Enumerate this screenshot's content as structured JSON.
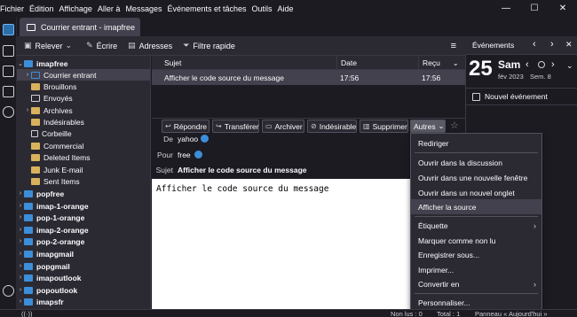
{
  "menubar": {
    "items": [
      "Fichier",
      "Édition",
      "Affichage",
      "Aller à",
      "Messages",
      "Événements et tâches",
      "Outils",
      "Aide"
    ]
  },
  "window_controls": {
    "minimize": "—",
    "maximize": "☐",
    "close": "✕"
  },
  "tab": {
    "title": "Courrier entrant - imapfree"
  },
  "toolbar": {
    "get_messages": "Relever",
    "write": "Écrire",
    "address_book": "Adresses",
    "quick_filter": "Filtre rapide",
    "menu_icon": "≡"
  },
  "folders": [
    {
      "label": "imapfree",
      "type": "account",
      "expanded": true,
      "bold": true
    },
    {
      "label": "Courrier entrant",
      "type": "inbox",
      "selected": true
    },
    {
      "label": "Brouillons",
      "type": "folder"
    },
    {
      "label": "Envoyés",
      "type": "sent"
    },
    {
      "label": "Archives",
      "type": "folder",
      "collapsible": true
    },
    {
      "label": "Indésirables",
      "type": "folder"
    },
    {
      "label": "Corbeille",
      "type": "trash"
    },
    {
      "label": "Commercial",
      "type": "folder"
    },
    {
      "label": "Deleted Items",
      "type": "folder"
    },
    {
      "label": "Junk E-mail",
      "type": "folder"
    },
    {
      "label": "Sent Items",
      "type": "folder"
    },
    {
      "label": "popfree",
      "type": "account",
      "bold": true
    },
    {
      "label": "imap-1-orange",
      "type": "account",
      "bold": true
    },
    {
      "label": "pop-1-orange",
      "type": "account",
      "bold": true
    },
    {
      "label": "imap-2-orange",
      "type": "account",
      "bold": true
    },
    {
      "label": "pop-2-orange",
      "type": "account",
      "bold": true
    },
    {
      "label": "imapgmail",
      "type": "account",
      "bold": true
    },
    {
      "label": "popgmail",
      "type": "account",
      "bold": true
    },
    {
      "label": "imapoutlook",
      "type": "account",
      "bold": true
    },
    {
      "label": "popoutlook",
      "type": "account",
      "bold": true
    },
    {
      "label": "imapsfr",
      "type": "account",
      "bold": true
    }
  ],
  "message_list": {
    "columns": {
      "subject": "Sujet",
      "date": "Date",
      "received": "Reçu"
    },
    "rows": [
      {
        "subject": "Afficher le code source du message",
        "date": "17:56",
        "received": "17:56"
      }
    ]
  },
  "message_actions": {
    "reply": "Répondre",
    "forward": "Transférer",
    "archive": "Archiver",
    "junk": "Indésirable",
    "delete": "Supprimer",
    "more": "Autres"
  },
  "message_header": {
    "from_label": "De",
    "from_value": "yahoo",
    "to_label": "Pour",
    "to_value": "free",
    "subject_label": "Sujet",
    "subject_value": "Afficher le code source du message"
  },
  "message_body": "Afficher le code source du message",
  "more_menu": {
    "items": [
      {
        "label": "Rediriger"
      },
      {
        "separator": true
      },
      {
        "label": "Ouvrir dans la discussion"
      },
      {
        "label": "Ouvrir dans une nouvelle fenêtre"
      },
      {
        "label": "Ouvrir dans un nouvel onglet"
      },
      {
        "label": "Afficher la source",
        "highlighted": true
      },
      {
        "separator": true
      },
      {
        "label": "Étiquette",
        "submenu": true
      },
      {
        "label": "Marquer comme non lu"
      },
      {
        "label": "Enregistrer sous..."
      },
      {
        "label": "Imprimer..."
      },
      {
        "label": "Convertir en",
        "submenu": true
      },
      {
        "separator": true
      },
      {
        "label": "Personnaliser..."
      }
    ]
  },
  "today_pane": {
    "title": "Événements",
    "day_number": "25",
    "day_name": "Sam",
    "month_year": "fév 2023",
    "week": "Sem. 8",
    "new_event": "Nouvel événement"
  },
  "status_bar": {
    "unread": "Non lus : 0",
    "total": "Total : 1",
    "panel": "Panneau « Aujourd'hui »"
  }
}
